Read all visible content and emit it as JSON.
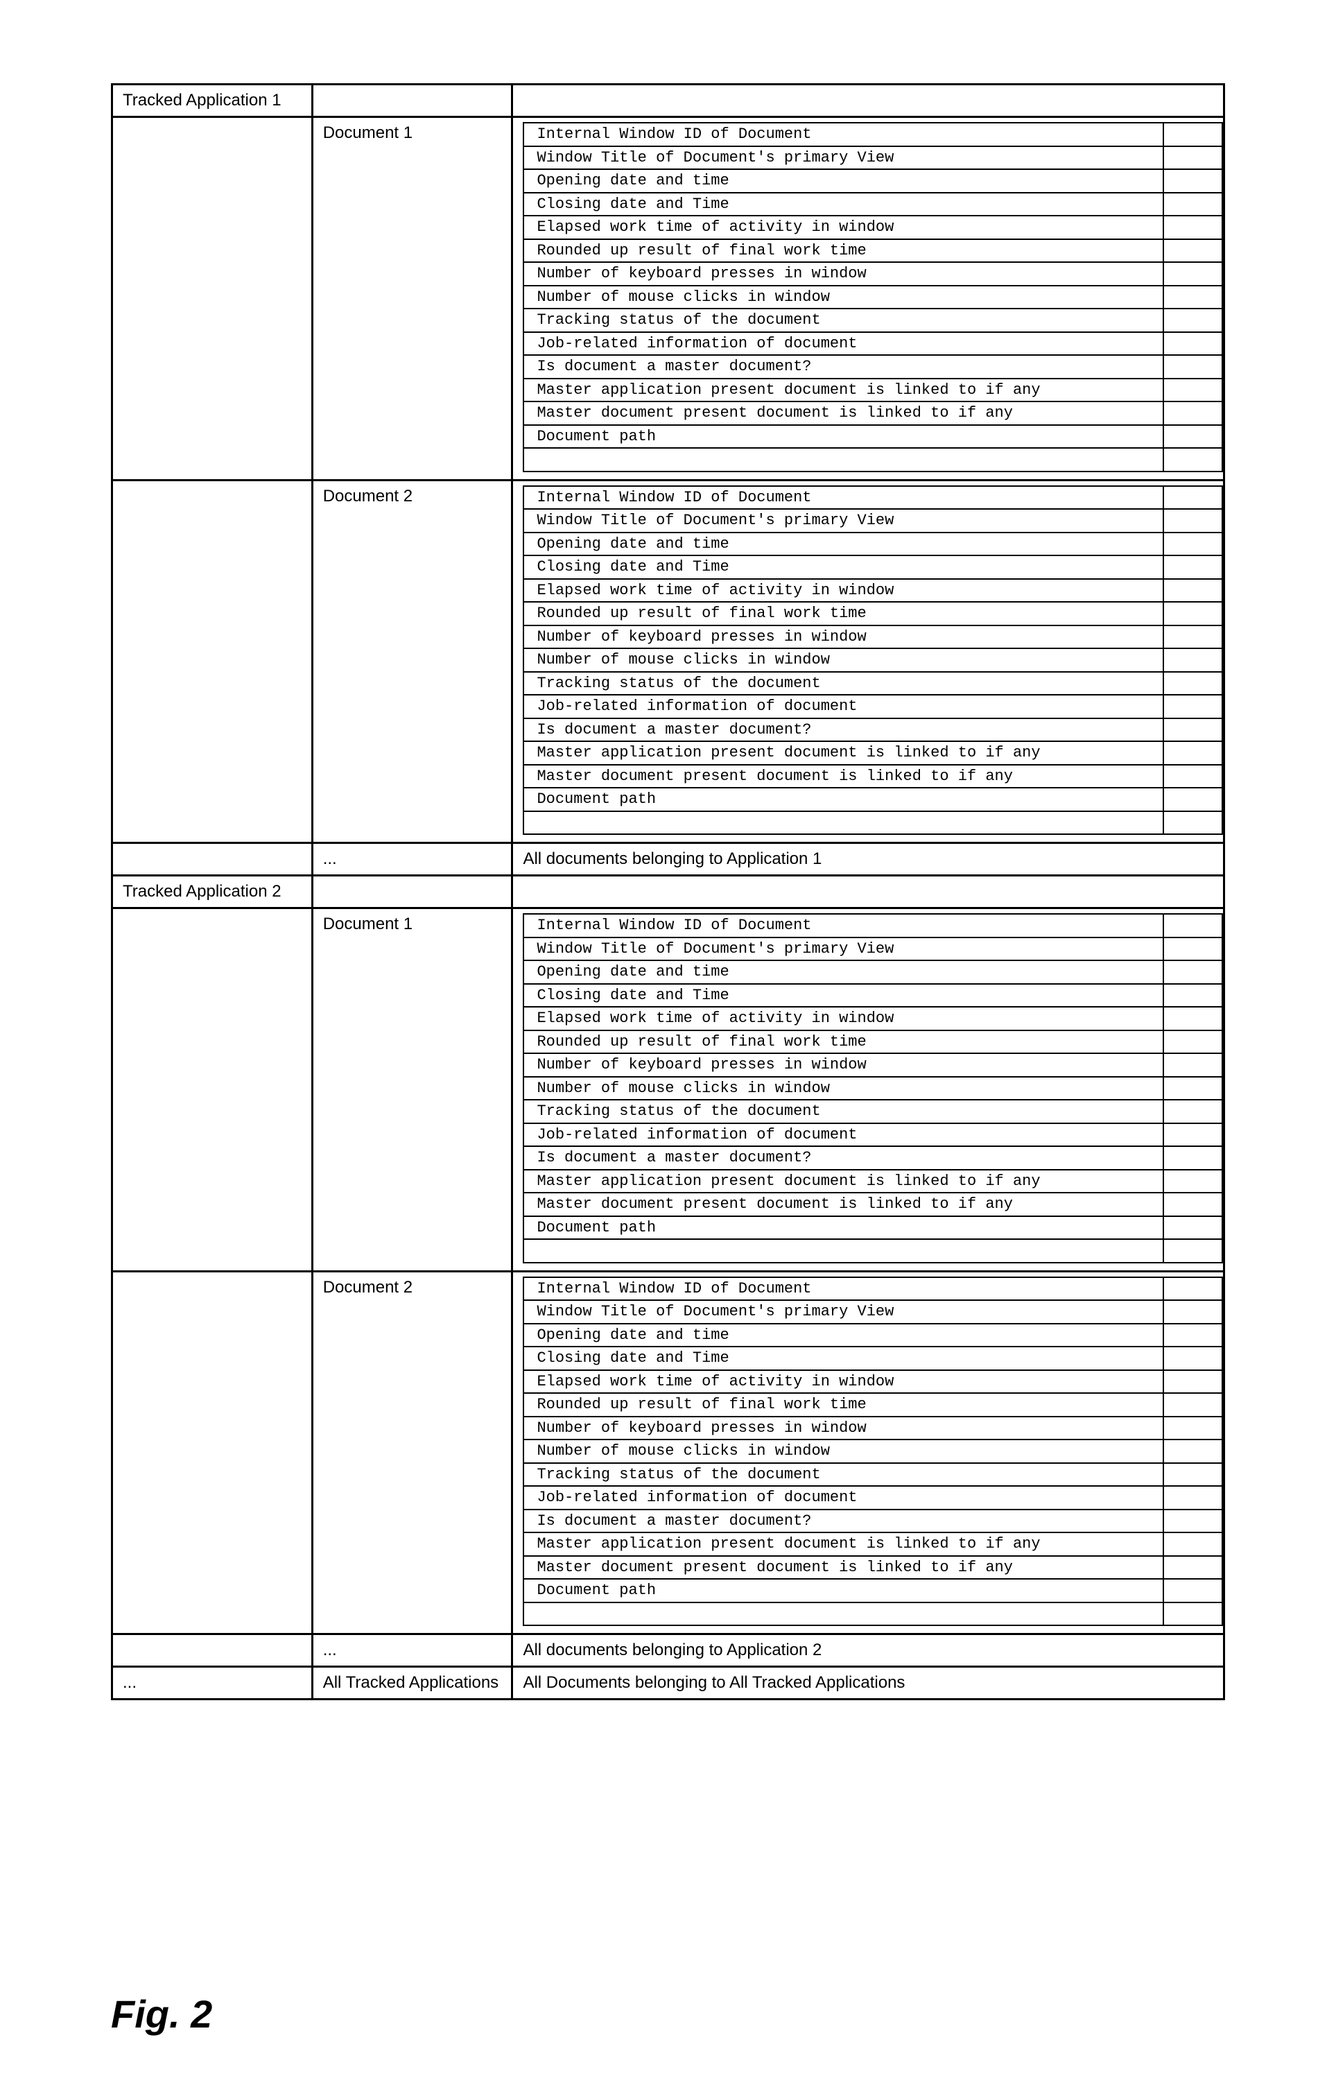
{
  "figure_label": "Fig. 2",
  "labels": {
    "app1": "Tracked Application 1",
    "app2": "Tracked Application 2",
    "doc1": "Document 1",
    "doc2": "Document 2",
    "ellipsis": "...",
    "all_docs_app1": "All documents belonging to Application 1",
    "all_docs_app2": "All documents belonging to Application 2",
    "all_tracked_apps": "All Tracked Applications",
    "all_docs_all_apps": "All Documents belonging to All Tracked Applications"
  },
  "detail_fields": [
    "Internal Window ID of Document",
    "Window Title of Document's primary View",
    "Opening date and time",
    "Closing date and Time",
    "Elapsed work time of activity in window",
    "Rounded up result of final work time",
    "Number of keyboard presses in window",
    "Number of mouse clicks in window",
    "Tracking status of the document",
    "Job-related information of document",
    "Is document a master document?",
    "Master application present document is linked to if any",
    "Master document present document is linked to if any",
    "Document path"
  ]
}
